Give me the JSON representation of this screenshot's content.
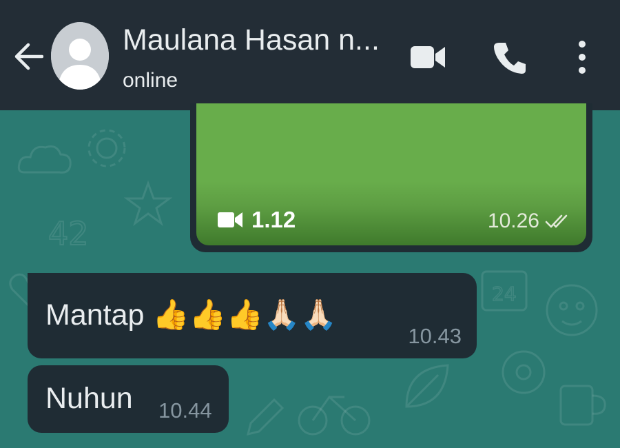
{
  "header": {
    "contact_name": "Maulana Hasan n...",
    "status": "online",
    "icons": [
      "back-arrow-icon",
      "avatar-placeholder-icon",
      "video-call-icon",
      "phone-call-icon",
      "more-options-icon"
    ]
  },
  "messages": [
    {
      "type": "video",
      "direction": "outgoing",
      "duration": "1.12",
      "time": "10.26",
      "status": "read"
    },
    {
      "type": "text",
      "direction": "incoming",
      "text": "Mantap 👍👍👍🙏🏻🙏🏻",
      "time": "10.43"
    },
    {
      "type": "text",
      "direction": "incoming",
      "text": "Nuhun",
      "time": "10.44"
    }
  ],
  "colors": {
    "header_bg": "#232d36",
    "chat_bg": "#2b7a72",
    "bubble_bg": "#1f2c34",
    "video_thumb": "#68ad4b",
    "text": "#e9edef",
    "timestamp": "#8696a0"
  }
}
